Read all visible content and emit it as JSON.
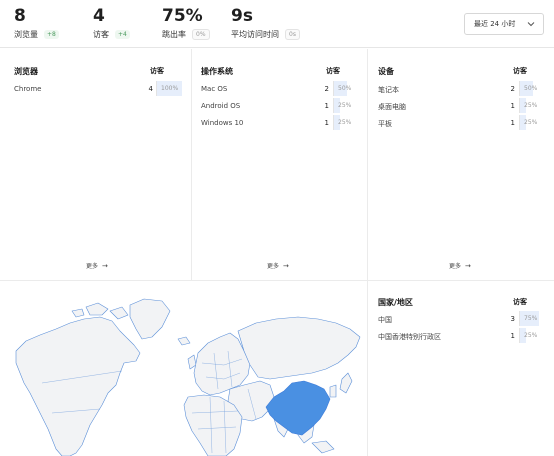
{
  "stats": [
    {
      "value": "8",
      "label": "浏览量",
      "badge": "+8",
      "badge_type": "up"
    },
    {
      "value": "4",
      "label": "访客",
      "badge": "+4",
      "badge_type": "up"
    },
    {
      "value": "75%",
      "label": "跳出率",
      "badge": "0%",
      "badge_type": "zero"
    },
    {
      "value": "9s",
      "label": "平均访问时间",
      "badge": "0s",
      "badge_type": "zero"
    }
  ],
  "range": {
    "label": "最近 24 小时"
  },
  "browsers": {
    "title": "浏览器",
    "col": "访客",
    "rows": [
      {
        "name": "Chrome",
        "count": "4",
        "pct": "100%",
        "fraction": 1.0
      }
    ],
    "more": "更多"
  },
  "os": {
    "title": "操作系统",
    "col": "访客",
    "rows": [
      {
        "name": "Mac OS",
        "count": "2",
        "pct": "50%",
        "fraction": 0.5
      },
      {
        "name": "Android OS",
        "count": "1",
        "pct": "25%",
        "fraction": 0.25
      },
      {
        "name": "Windows 10",
        "count": "1",
        "pct": "25%",
        "fraction": 0.25
      }
    ],
    "more": "更多"
  },
  "devices": {
    "title": "设备",
    "col": "访客",
    "rows": [
      {
        "name": "笔记本",
        "count": "2",
        "pct": "50%",
        "fraction": 0.5
      },
      {
        "name": "桌面电脑",
        "count": "1",
        "pct": "25%",
        "fraction": 0.25
      },
      {
        "name": "平板",
        "count": "1",
        "pct": "25%",
        "fraction": 0.25
      }
    ],
    "more": "更多"
  },
  "countries": {
    "title": "国家/地区",
    "col": "访客",
    "rows": [
      {
        "name": "中国",
        "count": "3",
        "pct": "75%",
        "fraction": 0.75
      },
      {
        "name": "中国香港特别行政区",
        "count": "1",
        "pct": "25%",
        "fraction": 0.25
      }
    ]
  },
  "colors": {
    "highlight": "#4a90e2",
    "land": "#f2f3f5",
    "border": "#3d7bd9",
    "bar": "#e6eefb"
  }
}
